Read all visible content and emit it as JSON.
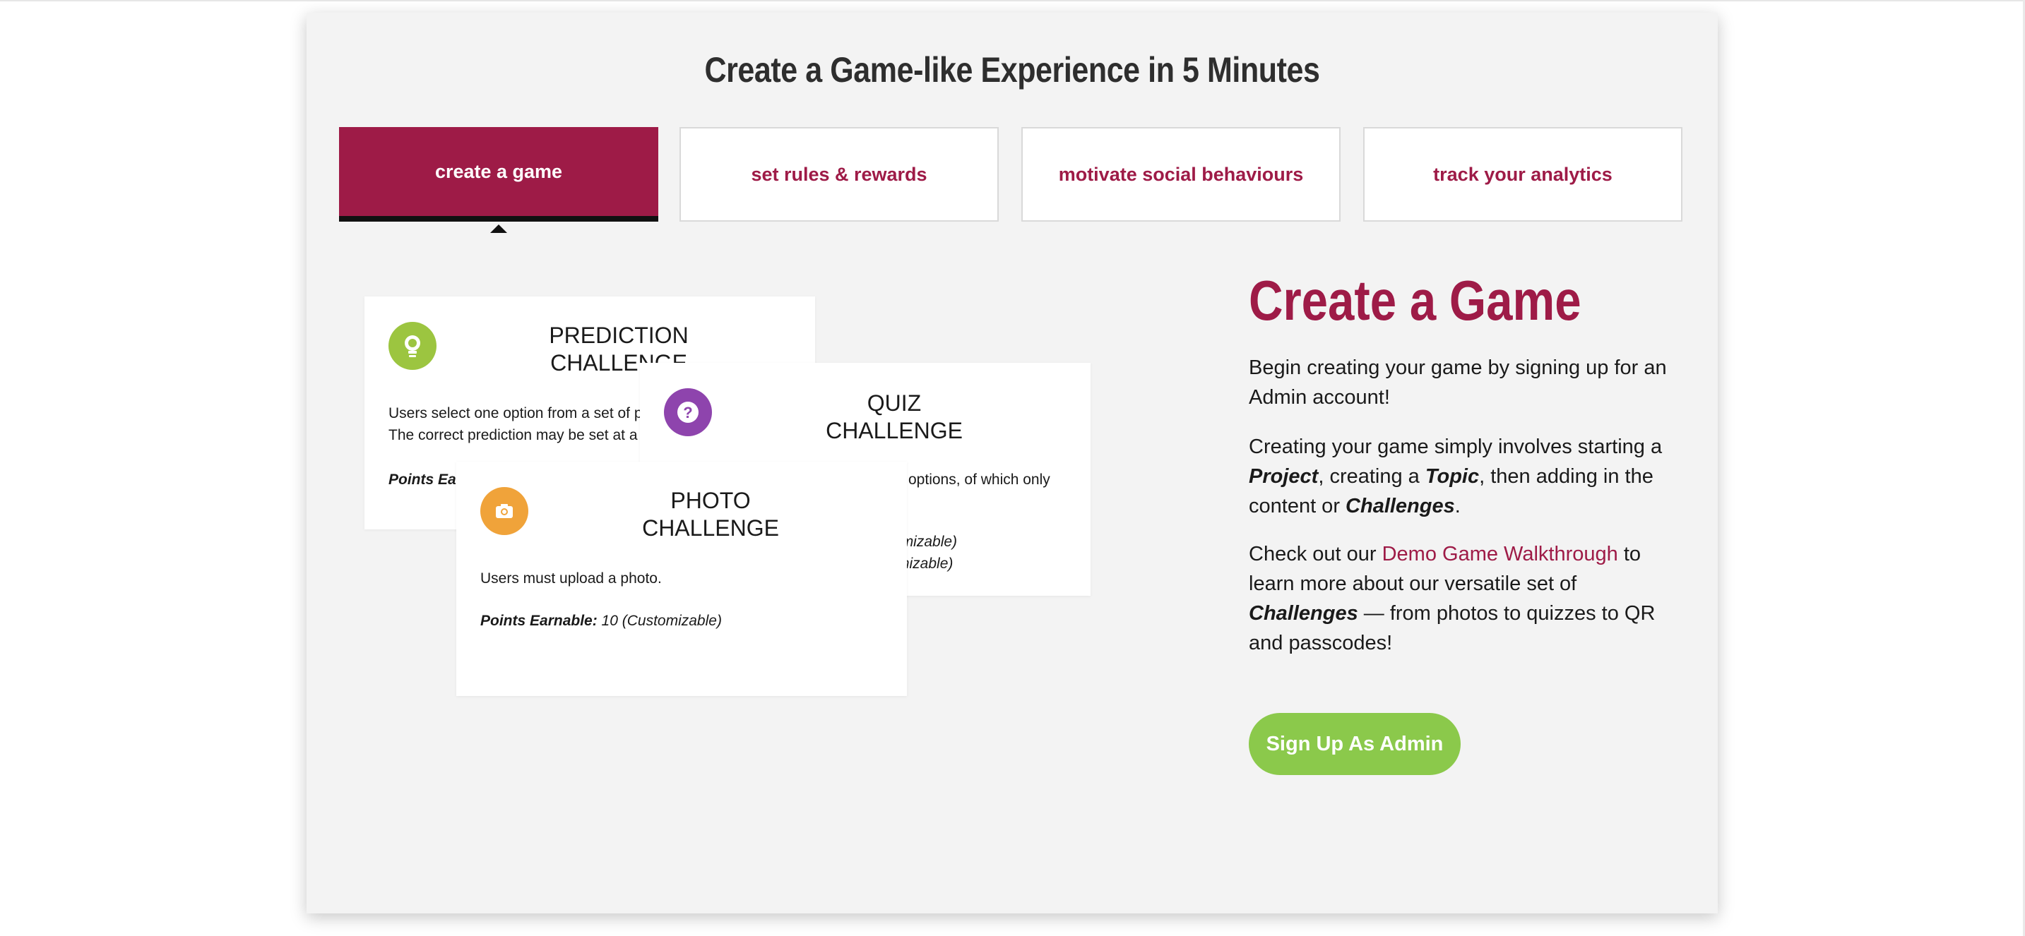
{
  "section": {
    "heading": "Create a Game-like Experience in 5 Minutes"
  },
  "tabs": [
    {
      "label": "create a game",
      "active": true
    },
    {
      "label": "set rules & rewards",
      "active": false
    },
    {
      "label": "motivate social behaviours",
      "active": false
    },
    {
      "label": "track your analytics",
      "active": false
    }
  ],
  "cards": {
    "prediction": {
      "title_line1": "PREDICTION",
      "title_line2": "CHALLENGE",
      "desc_line1": "Users select one option from a set of p",
      "desc_line2": "The correct prediction may be set at a",
      "points_label": "Points Ea",
      "icon": "lightbulb-icon",
      "icon_color": "#9cc540"
    },
    "quiz": {
      "title_line1": "QUIZ",
      "title_line2": "CHALLENGE",
      "desc_fragment": "options, of which only",
      "points_fragment_1": "ustomizable)",
      "points_fragment_2": "stomizable)",
      "icon": "question-icon",
      "icon_color": "#8e44ad"
    },
    "photo": {
      "title_line1": "PHOTO",
      "title_line2": "CHALLENGE",
      "desc": "Users must upload a photo.",
      "points_label": "Points Earnable:",
      "points_value": " 10 (Customizable)",
      "icon": "camera-icon",
      "icon_color": "#f0a33a"
    }
  },
  "content": {
    "title": "Create a Game",
    "p1": "Begin creating your game by signing up for an Admin account!",
    "p2_a": "Creating your game simply involves starting a ",
    "p2_project": "Project",
    "p2_b": ", creating a ",
    "p2_topic": "Topic",
    "p2_c": ", then adding in the content or ",
    "p2_challenges": "Challenges",
    "p2_d": ".",
    "p3_a": "Check out our ",
    "p3_link": "Demo Game Walkthrough",
    "p3_b": " to learn more about our versatile set of ",
    "p3_challenges": "Challenges",
    "p3_c": " — from photos to quizzes to QR and passcodes!",
    "signup_label": "Sign Up As Admin"
  },
  "colors": {
    "brand": "#9e1b47",
    "accent_green": "#8bc94b",
    "panel_bg": "#f3f3f3"
  }
}
